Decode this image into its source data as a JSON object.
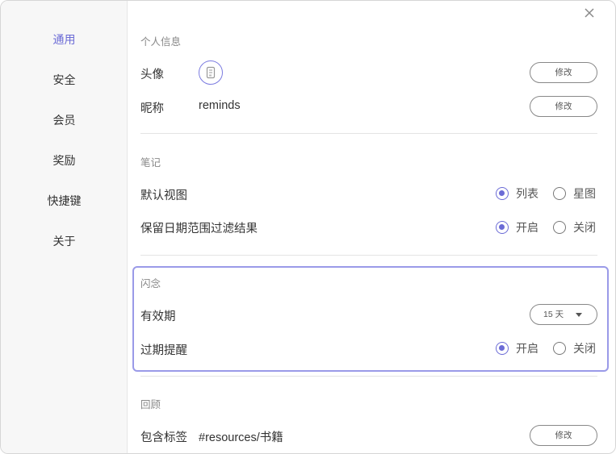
{
  "close_icon": "close-icon",
  "sidebar": {
    "items": [
      {
        "label": "通用",
        "active": true
      },
      {
        "label": "安全"
      },
      {
        "label": "会员"
      },
      {
        "label": "奖励"
      },
      {
        "label": "快捷键"
      },
      {
        "label": "关于"
      }
    ]
  },
  "personal": {
    "title": "个人信息",
    "avatar_label": "头像",
    "avatar_icon": "avatar-placeholder-icon",
    "avatar_button": "修改",
    "nickname_label": "昵称",
    "nickname_value": "reminds",
    "nickname_button": "修改"
  },
  "notes": {
    "title": "笔记",
    "default_view_label": "默认视图",
    "default_view_options": [
      "列表",
      "星图"
    ],
    "default_view_selected": "列表",
    "keep_filter_label": "保留日期范围过滤结果",
    "keep_filter_options": [
      "开启",
      "关闭"
    ],
    "keep_filter_selected": "开启"
  },
  "flash": {
    "title": "闪念",
    "validity_label": "有效期",
    "validity_value": "15 天",
    "reminder_label": "过期提醒",
    "reminder_options": [
      "开启",
      "关闭"
    ],
    "reminder_selected": "开启"
  },
  "review": {
    "title": "回顾",
    "tags_label": "包含标签",
    "tags_value": "#resources/书籍",
    "tags_button": "修改"
  },
  "colors": {
    "accent": "#6b6bd6",
    "highlight_border": "#9a9ae8"
  }
}
